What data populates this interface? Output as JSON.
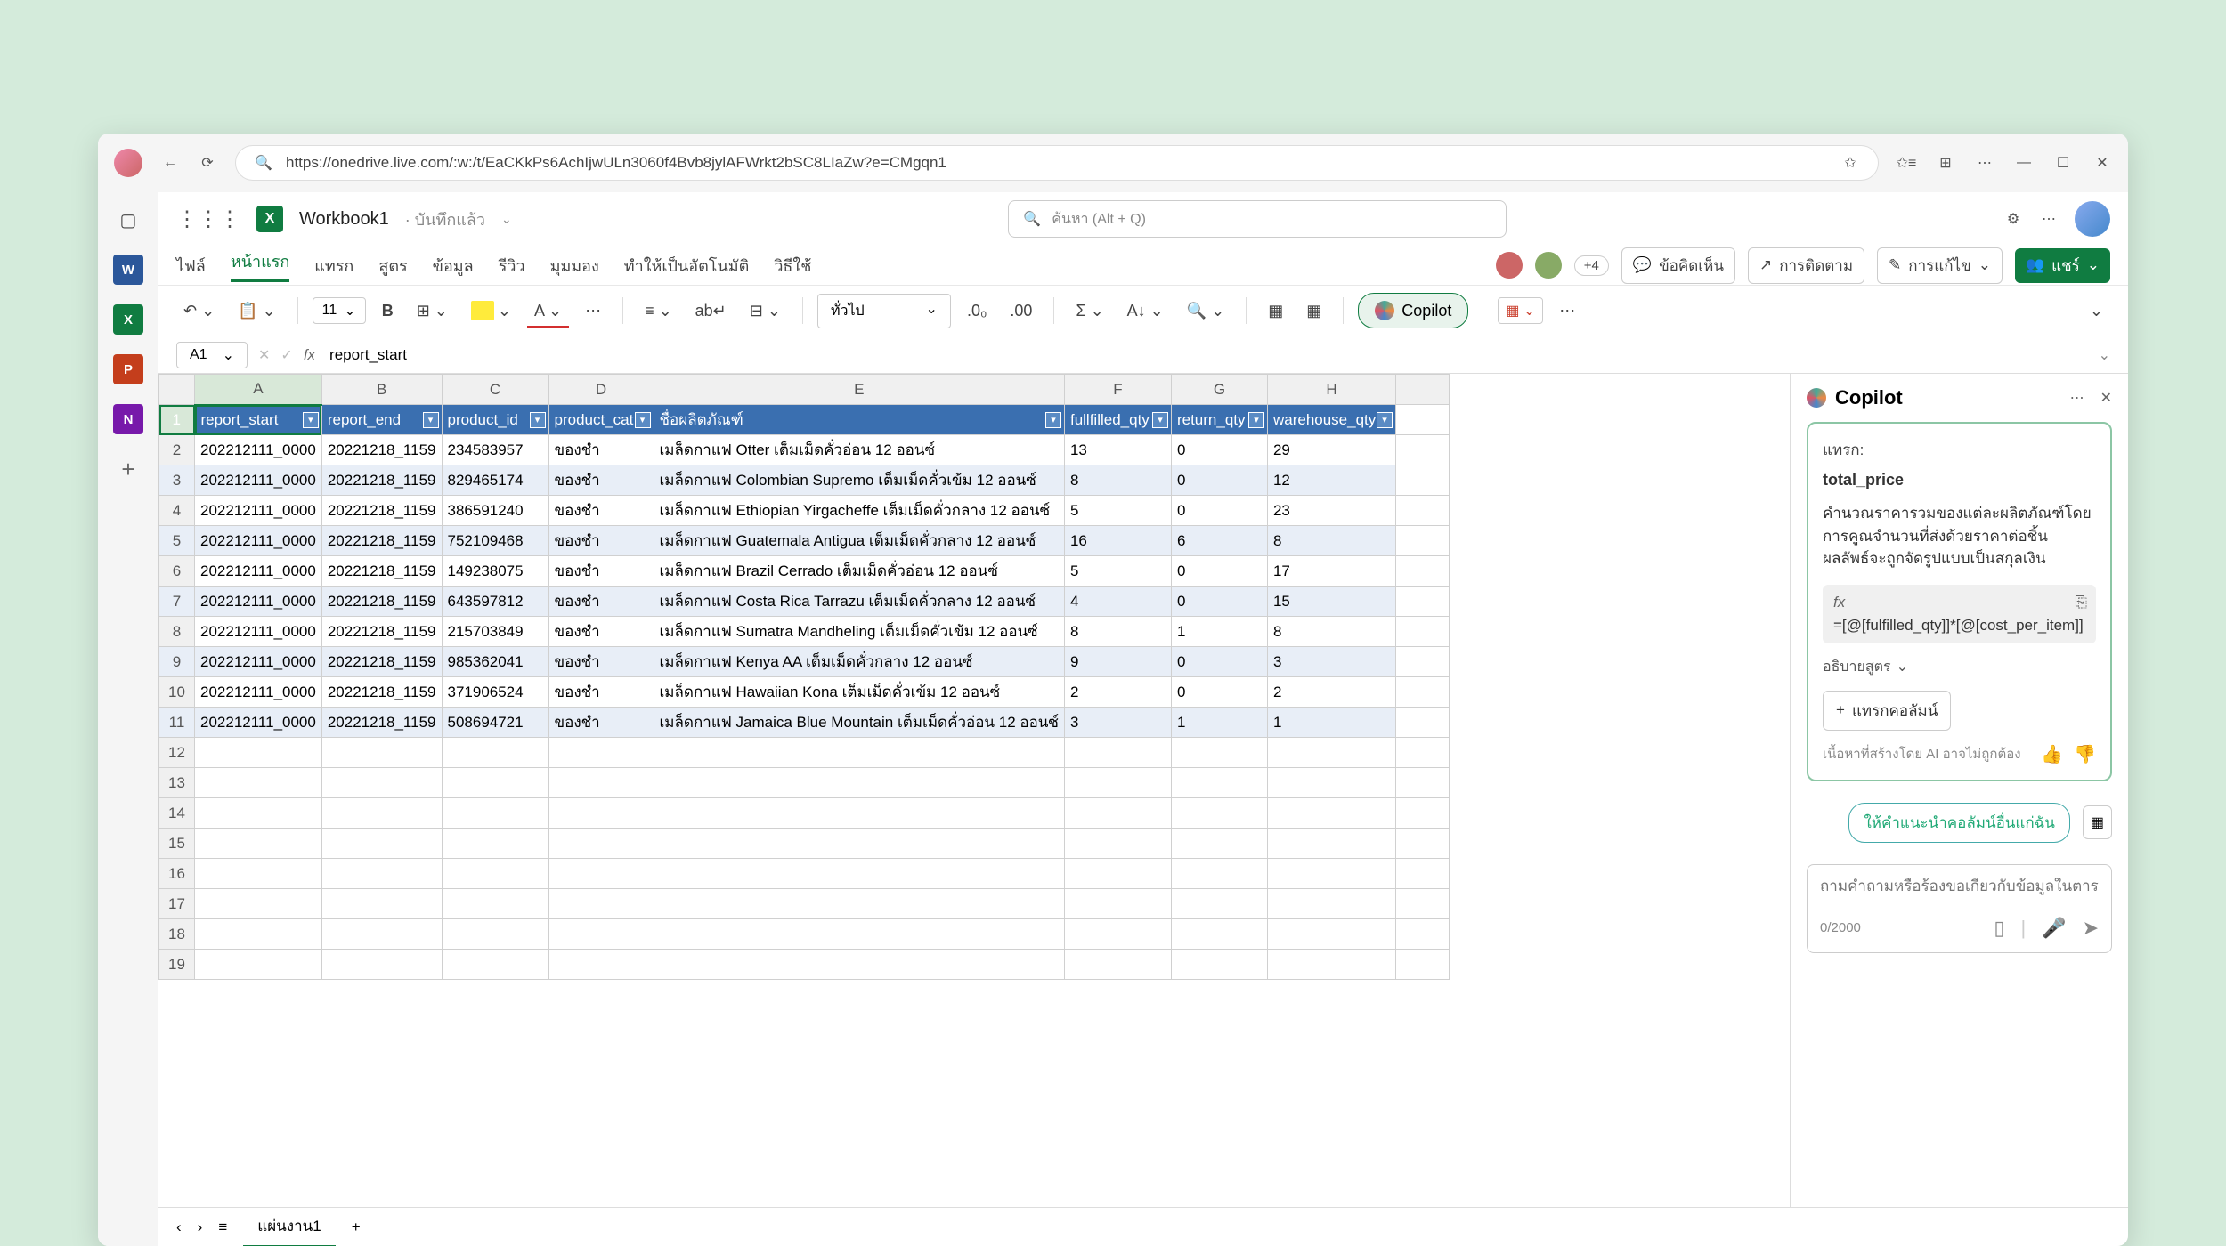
{
  "browser": {
    "url": "https://onedrive.live.com/:w:/t/EaCKkPs6AchIjwULn3060f4Bvb8jylAFWrkt2bSC8LIaZw?e=CMgqn1"
  },
  "title": {
    "workbook": "Workbook1",
    "saved": "· บันทึกแล้ว",
    "search_placeholder": "ค้นหา (Alt + Q)"
  },
  "tabs": {
    "file": "ไฟล์",
    "home": "หน้าแรก",
    "insert": "แทรก",
    "formulas": "สูตร",
    "data": "ข้อมูล",
    "review": "รีวิว",
    "view": "มุมมอง",
    "automate": "ทำให้เป็นอัตโนมัติ",
    "help": "วิธีใช้",
    "plus4": "+4",
    "comments": "ข้อคิดเห็น",
    "catchup": "การติดตาม",
    "editing": "การแก้ไข",
    "share": "แชร์"
  },
  "toolbar": {
    "font_size": "11",
    "number_format": "ทั่วไป",
    "copilot": "Copilot"
  },
  "formula_bar": {
    "cell": "A1",
    "value": "report_start"
  },
  "columns": [
    "A",
    "B",
    "C",
    "D",
    "E",
    "F",
    "G",
    "H"
  ],
  "headers": {
    "A": "report_start",
    "B": "report_end",
    "C": "product_id",
    "D": "product_cat",
    "E": "ชื่อผลิตภัณฑ์",
    "F": "fullfilled_qty",
    "G": "return_qty",
    "H": "warehouse_qty"
  },
  "rows": [
    {
      "A": "202212111_0000",
      "B": "20221218_1159",
      "C": "234583957",
      "D": "ของชำ",
      "E": "เมล็ดกาแฟ Otter เต็มเม็ดคั่วอ่อน 12 ออนซ์",
      "F": "13",
      "G": "0",
      "H": "29"
    },
    {
      "A": "202212111_0000",
      "B": "20221218_1159",
      "C": "829465174",
      "D": "ของชำ",
      "E": "เมล็ดกาแฟ Colombian Supremo เต็มเม็ดคั่วเข้ม 12 ออนซ์",
      "F": "8",
      "G": "0",
      "H": "12"
    },
    {
      "A": "202212111_0000",
      "B": "20221218_1159",
      "C": "386591240",
      "D": "ของชำ",
      "E": "เมล็ดกาแฟ Ethiopian Yirgacheffe เต็มเม็ดคั่วกลาง 12 ออนซ์",
      "F": "5",
      "G": "0",
      "H": "23"
    },
    {
      "A": "202212111_0000",
      "B": "20221218_1159",
      "C": "752109468",
      "D": "ของชำ",
      "E": "เมล็ดกาแฟ Guatemala Antigua เต็มเม็ดคั่วกลาง 12 ออนซ์",
      "F": "16",
      "G": "6",
      "H": "8"
    },
    {
      "A": "202212111_0000",
      "B": "20221218_1159",
      "C": "149238075",
      "D": "ของชำ",
      "E": "เมล็ดกาแฟ Brazil Cerrado เต็มเม็ดคั่วอ่อน 12 ออนซ์",
      "F": "5",
      "G": "0",
      "H": "17"
    },
    {
      "A": "202212111_0000",
      "B": "20221218_1159",
      "C": "643597812",
      "D": "ของชำ",
      "E": "เมล็ดกาแฟ Costa Rica Tarrazu เต็มเม็ดคั่วกลาง 12 ออนซ์",
      "F": "4",
      "G": "0",
      "H": "15"
    },
    {
      "A": "202212111_0000",
      "B": "20221218_1159",
      "C": "215703849",
      "D": "ของชำ",
      "E": "เมล็ดกาแฟ Sumatra Mandheling เต็มเม็ดคั่วเข้ม 12 ออนซ์",
      "F": "8",
      "G": "1",
      "H": "8"
    },
    {
      "A": "202212111_0000",
      "B": "20221218_1159",
      "C": "985362041",
      "D": "ของชำ",
      "E": "เมล็ดกาแฟ Kenya AA เต็มเม็ดคั่วกลาง 12 ออนซ์",
      "F": "9",
      "G": "0",
      "H": "3"
    },
    {
      "A": "202212111_0000",
      "B": "20221218_1159",
      "C": "371906524",
      "D": "ของชำ",
      "E": "เมล็ดกาแฟ Hawaiian Kona เต็มเม็ดคั่วเข้ม 12 ออนซ์",
      "F": "2",
      "G": "0",
      "H": "2"
    },
    {
      "A": "202212111_0000",
      "B": "20221218_1159",
      "C": "508694721",
      "D": "ของชำ",
      "E": "เมล็ดกาแฟ Jamaica Blue Mountain เต็มเม็ดคั่วอ่อน 12 ออนซ์",
      "F": "3",
      "G": "1",
      "H": "1"
    }
  ],
  "empty_rows": [
    "12",
    "13",
    "14",
    "15",
    "16",
    "17",
    "18",
    "19"
  ],
  "copilot": {
    "title": "Copilot",
    "sub": "แทรก:",
    "col": "total_price",
    "desc": "คำนวณราคารวมของแต่ละผลิตภัณฑ์โดยการคูณจำนวนที่ส่งด้วยราคาต่อชิ้น ผลลัพธ์จะถูกจัดรูปแบบเป็นสกุลเงิน",
    "formula": "=[@[fulfilled_qty]]*[@[cost_per_item]]",
    "explain": "อธิบายสูตร",
    "insert": "แทรกคอลัมน์",
    "disclaimer": "เนื้อหาที่สร้างโดย AI อาจไม่ถูกต้อง",
    "suggest": "ให้คำแนะนำคอลัมน์อื่นแก่ฉัน",
    "placeholder": "ถามคำถามหรือร้องขอเกี่ยวกับข้อมูลในตาราง",
    "counter": "0/2000"
  },
  "sheet": {
    "tab": "แผ่นงาน1"
  }
}
